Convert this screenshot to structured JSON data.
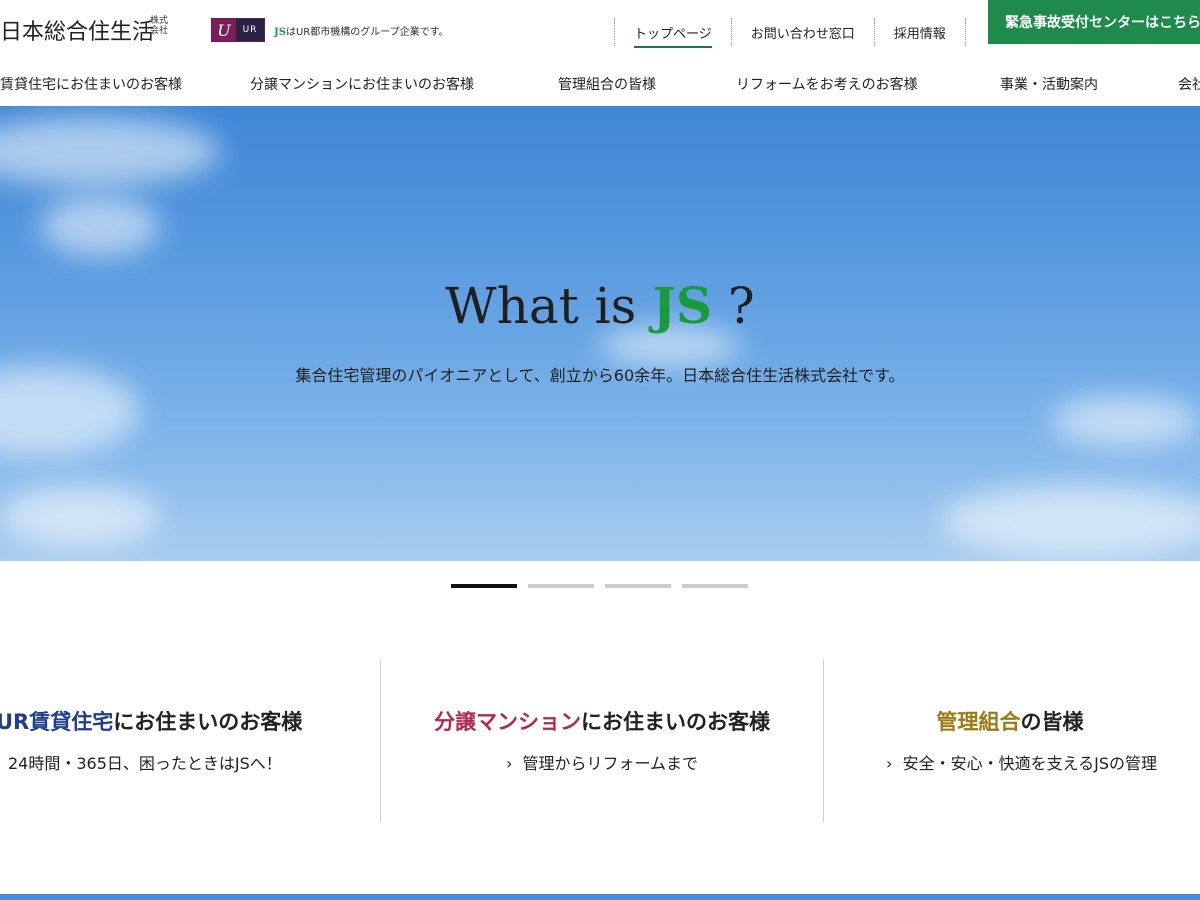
{
  "header": {
    "logo_text": "日本総合住生活",
    "logo_small": "株式会社",
    "ur_mark": "U",
    "ur_label": "UR",
    "js_mark": "JS",
    "js_note": "はUR都市機構のグループ企業です。",
    "top_links": [
      "トップページ",
      "お問い合わせ窓口",
      "採用情報"
    ],
    "emergency": "緊急事故受付センターはこちら"
  },
  "nav": {
    "items": [
      "賃貸住宅にお住まいのお客様",
      "分譲マンションにお住まいのお客様",
      "管理組合の皆様",
      "リフォームをお考えのお客様",
      "事業・活動案内",
      "会社"
    ]
  },
  "hero": {
    "title_pre": "What is ",
    "title_js": "JS",
    "title_post": " ?",
    "subtitle": "集合住宅管理のパイオニアとして、創立から60余年。日本総合住生活株式会社です。"
  },
  "slider": {
    "count": 4,
    "active": 0
  },
  "cards": [
    {
      "title_accent": "UR賃貸住宅",
      "title_rest": "にお住まいのお客様",
      "sub": "24時間・365日、困ったときはJSへ！"
    },
    {
      "title_accent": "分譲マンション",
      "title_rest": "にお住まいのお客様",
      "sub": "管理からリフォームまで"
    },
    {
      "title_accent": "管理組合",
      "title_rest": "の皆様",
      "sub": "安全・安心・快適を支えるJSの管理"
    }
  ],
  "colors": {
    "brand_green": "#1e8a4c",
    "js_green": "#1a9a3a",
    "ur_purple": "#7a1f57"
  }
}
